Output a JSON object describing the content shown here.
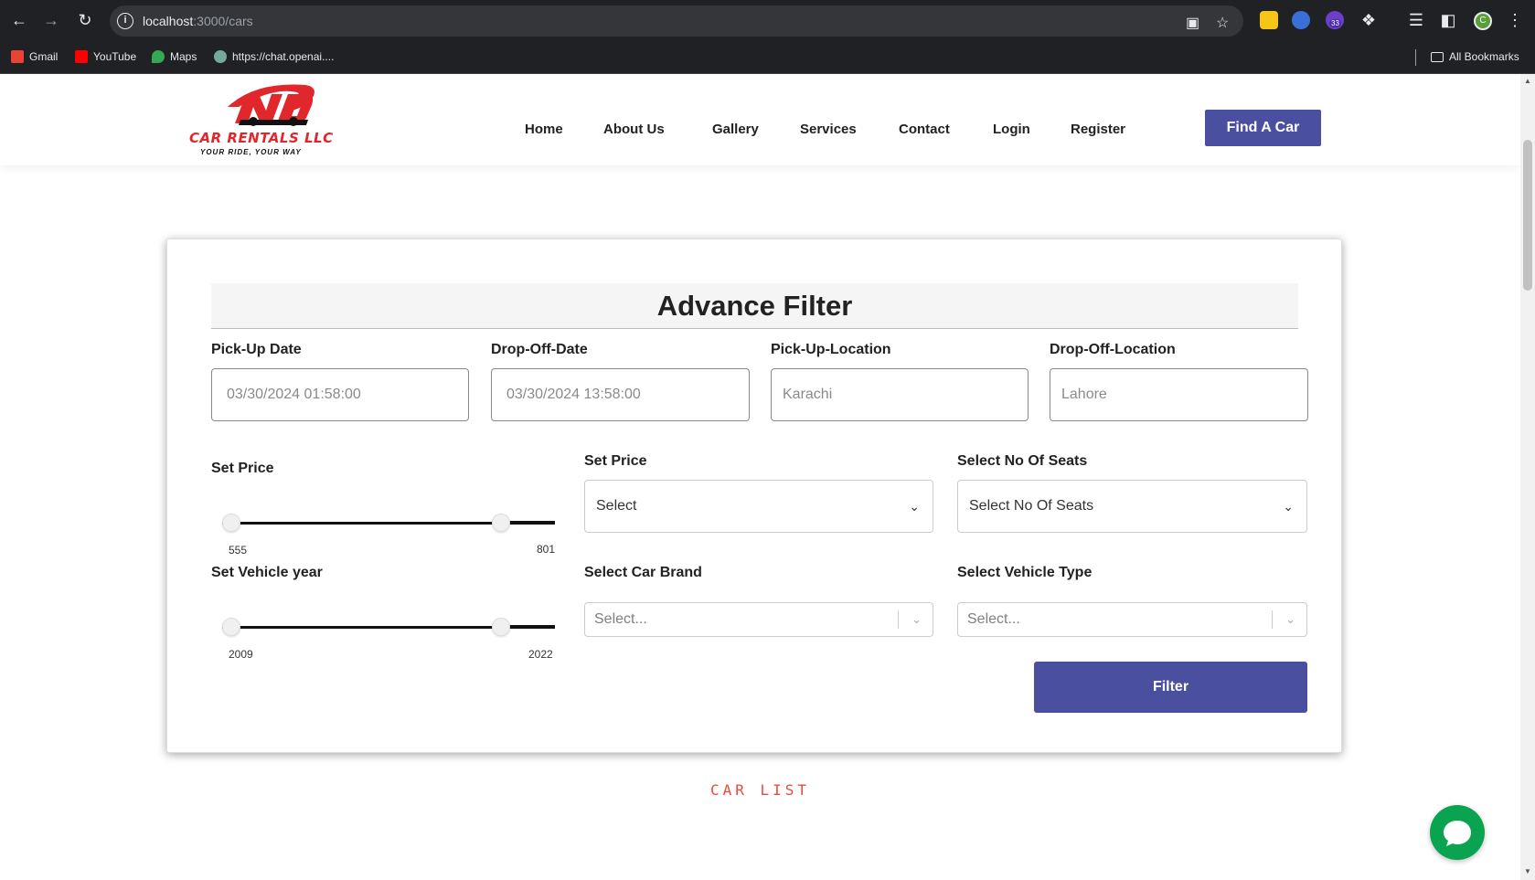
{
  "browser": {
    "url_host": "localhost",
    "url_path": ":3000/cars",
    "profile_initial": "C",
    "extension_badge": "33",
    "bookmarks": [
      {
        "label": "Gmail",
        "icon": "gmail-icon",
        "color": "#ea4335"
      },
      {
        "label": "YouTube",
        "icon": "youtube-icon",
        "color": "#ff0000"
      },
      {
        "label": "Maps",
        "icon": "maps-icon",
        "color": "#34a853"
      },
      {
        "label": "https://chat.openai....",
        "icon": "openai-icon",
        "color": "#74aa9c"
      }
    ],
    "all_bookmarks": "All Bookmarks"
  },
  "header": {
    "logo_brand": "CAR RENTALS LLC",
    "logo_tagline": "YOUR RIDE, YOUR WAY",
    "nav": [
      {
        "label": "Home"
      },
      {
        "label": "About Us"
      },
      {
        "label": "Gallery"
      },
      {
        "label": "Services"
      },
      {
        "label": "Contact"
      },
      {
        "label": "Login"
      },
      {
        "label": "Register"
      }
    ],
    "cta": "Find A Car",
    "accent": "#4a4fa0"
  },
  "filter": {
    "title": "Advance Filter",
    "pickup_date": {
      "label": "Pick-Up Date",
      "value": "03/30/2024 01:58:00"
    },
    "dropoff_date": {
      "label": "Drop-Off-Date",
      "value": "03/30/2024 13:58:00"
    },
    "pickup_location": {
      "label": "Pick-Up-Location",
      "value": "Karachi"
    },
    "dropoff_location": {
      "label": "Drop-Off-Location",
      "value": "Lahore"
    },
    "price_range": {
      "label": "Set Price",
      "min": "555",
      "max": "801"
    },
    "year_range": {
      "label": "Set Vehicle year",
      "min": "2009",
      "max": "2022"
    },
    "price_select": {
      "label": "Set Price",
      "value": "Select"
    },
    "seats_select": {
      "label": "Select No Of Seats",
      "value": "Select No Of Seats"
    },
    "brand_select": {
      "label": "Select Car Brand",
      "placeholder": "Select..."
    },
    "type_select": {
      "label": "Select Vehicle Type",
      "placeholder": "Select..."
    },
    "submit": "Filter"
  },
  "section": {
    "car_list": "CAR LIST"
  },
  "colors": {
    "chat": "#0aa350",
    "car_list": "#e74c3c",
    "logo_red": "#e1262c"
  }
}
